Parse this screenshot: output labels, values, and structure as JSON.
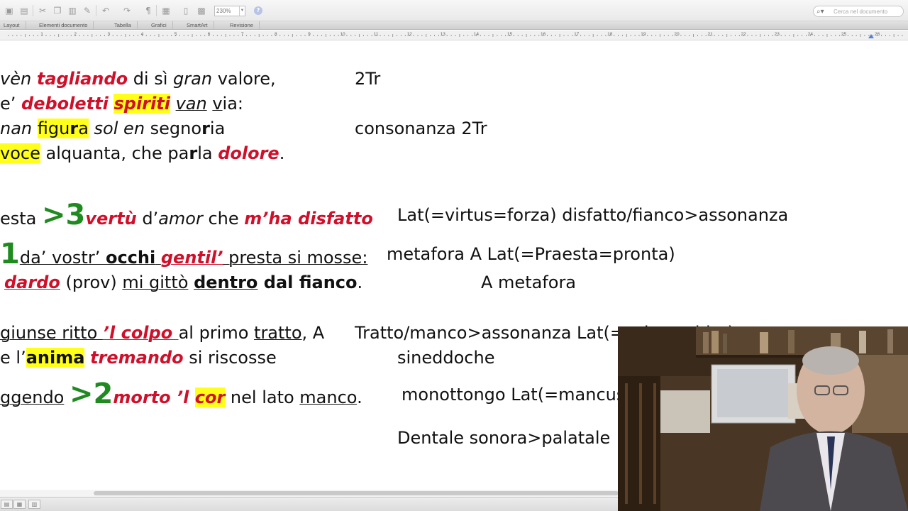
{
  "toolbar": {
    "zoom_value": "230%",
    "search_placeholder": "Cerca nel documento",
    "icons": [
      "save-icon",
      "print-icon",
      "cut-icon",
      "copy-icon",
      "paste-icon",
      "format-painter-icon",
      "undo-icon",
      "redo-icon",
      "pilcrow-icon",
      "view-icon",
      "sidebar-icon",
      "media-icon",
      "help-icon"
    ]
  },
  "ribbon": {
    "tabs": [
      "Layout",
      "Elementi documento",
      "Tabella",
      "Grafici",
      "SmartArt",
      "Revisione"
    ]
  },
  "ruler": {
    "numbers": [
      "1",
      "2",
      "3",
      "4",
      "5",
      "6",
      "7",
      "8",
      "9",
      "10",
      "11",
      "12",
      "13",
      "14",
      "15",
      "16",
      "17",
      "18",
      "19",
      "20",
      "21",
      "22",
      "23",
      "24",
      "25",
      "26",
      "27"
    ]
  },
  "doc": {
    "l1": {
      "a": "vèn ",
      "b": "tagliando",
      "c": " di sì ",
      "d": "gran",
      "e": " valore,"
    },
    "l1n": "2Tr",
    "l2": {
      "a": "e’ ",
      "b": "deboletti",
      "c": " ",
      "d": "spiriti",
      "e": " ",
      "f": "van",
      "g": " ",
      "h": "v",
      "i": "ia:"
    },
    "l3": {
      "a": "nan",
      "b": " ",
      "c": "figu",
      "d": "r",
      "e": "a",
      "f": " ",
      "g": "sol",
      "h": " ",
      "i": "en",
      "j": " segno",
      "k": "r",
      "l": "ia"
    },
    "l3n": "consonanza  2Tr",
    "l4": {
      "a": "voce",
      "b": " alquanta, che pa",
      "c": "r",
      "d": "la ",
      "e": "dolore",
      "f": "."
    },
    "l5": {
      "a": "esta ",
      "b": ">3",
      "c": "vertù",
      "d": " d’",
      "e": "amor",
      "f": " che ",
      "g": "m’ha disfatto"
    },
    "l5n": "Lat(=virtus=forza) disfatto/fianco>assonanza",
    "l6": {
      "a": "1",
      "b": "da’ vostr’ ",
      "c": "occhi",
      "d": " ",
      "e": "gentil’",
      "f": " presta si mosse:"
    },
    "l6n": "metafora   A  Lat(=Praesta=pronta)",
    "l7": {
      "a": "dardo",
      "b": " (prov) ",
      "c": "mi gittò",
      "d": " ",
      "e": "dentro",
      "f": " dal fianco",
      "g": "."
    },
    "l7n": "A  metafora",
    "l8": {
      "a": "giunse ritto ",
      "b": "’l colpo ",
      "c": "al primo ",
      "d": "tratto",
      "e": ",  A"
    },
    "l8n": "Tratto/manco>assonanza Lat(=colpo subito)",
    "l9": {
      "a": "e l’",
      "b": "anima",
      "c": " ",
      "d": "tremando",
      "e": " si riscosse"
    },
    "l9n": "sineddoche",
    "l10": {
      "a": "ggendo",
      "b": " ",
      "c": ">2",
      "d": "morto ’l ",
      "e": "cor",
      "f": " nel lato ",
      "g": "manco",
      "h": "."
    },
    "l10n": "monottongo Lat(=mancus)",
    "l11n": "Dentale sonora>palatale"
  },
  "colors": {
    "accent_red": "#d0102a",
    "accent_green": "#1f8a1f",
    "highlight": "#ffff1a"
  }
}
